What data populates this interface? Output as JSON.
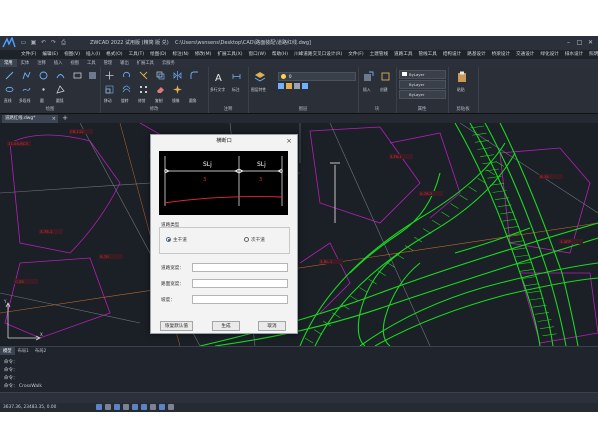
{
  "app": {
    "title": "ZWCAD 2022 试用版 (精简 版 兑)",
    "file_path": "C:\\Users\\wsnsens\\Desktop\\CAD\\路面装配\\道路红线.dwg]",
    "quick_access": [
      "open-icon",
      "save-icon",
      "undo-icon",
      "redo-icon",
      "print-icon"
    ],
    "window_buttons": [
      "–",
      "□",
      "✕"
    ]
  },
  "menu": [
    "文件(F)",
    "编辑(E)",
    "视图(V)",
    "插入(I)",
    "格式(O)",
    "工具(T)",
    "绘图(D)",
    "标注(N)",
    "修改(M)",
    "扩展工具(X)",
    "窗口(W)",
    "帮助(H)",
    "川峰道路交叉口设计(R)",
    "文件(F)",
    "土建管线",
    "道路工具",
    "管线工具",
    "结构设计",
    "路基设计",
    "桥梁设计",
    "交通设计",
    "绿化设计",
    "排水设计",
    "照明设计",
    "建筑设计"
  ],
  "ribbon_tabs": [
    "常用",
    "实体",
    "注释",
    "插入",
    "视图",
    "工具",
    "管理",
    "输出",
    "扩展工具",
    "云服务"
  ],
  "ribbon": {
    "groups": [
      "绘图",
      "修改",
      "注释",
      "图层",
      "块",
      "属性",
      "剪贴板"
    ],
    "draw_labels": [
      "直线",
      "多段线",
      "圆",
      "圆弧"
    ],
    "modify_labels": [
      "移动",
      "旋转",
      "修剪",
      "复制",
      "镜像",
      "圆角",
      "拉伸"
    ],
    "annot_labels": [
      "多行文字",
      "标注"
    ],
    "layer_label": "图层特性",
    "layer_current": "0",
    "block_labels": [
      "插入",
      "创建"
    ],
    "prop_values": [
      "ByLayer",
      "ByLayer",
      "ByLayer"
    ],
    "clip_labels": [
      "粘贴"
    ]
  },
  "document_tab": {
    "label": "道路红线.dwg*",
    "close": "×",
    "add": "+"
  },
  "drawing": {
    "red_labels": [
      "11.05-RC3",
      "CR-112",
      "C2-11",
      "3-75-1",
      "0-70",
      "C-55",
      "1-3FP1",
      "3-FK-1",
      "0-76-3",
      "R-15",
      "1-4FP",
      "3-RL-1"
    ]
  },
  "dialog": {
    "title": "横断口",
    "close": "×",
    "preview_labels": [
      "SLj",
      "SLj"
    ],
    "preview_red_labels": [
      "3",
      "3"
    ],
    "group_label": "道路类型",
    "radio_options": [
      "主干道",
      "次干道"
    ],
    "radio_selected": 0,
    "fields": [
      {
        "label": "道路宽度：",
        "value": ""
      },
      {
        "label": "路面宽度：",
        "value": ""
      },
      {
        "label": "坡度：",
        "value": ""
      }
    ],
    "buttons": [
      "恢复默认值",
      "生成",
      "取消"
    ]
  },
  "command": {
    "tabs": [
      "模型",
      "布局1",
      "布局2"
    ],
    "lines": [
      "命令：",
      "命令：",
      "命令：",
      "命令：  CrossWalk"
    ]
  },
  "status": {
    "coords": "3637.36, 23483.35, 0.00",
    "icons": [
      "grid-icon",
      "snap-icon",
      "ortho-icon",
      "polar-icon",
      "osnap-icon",
      "otrack-icon",
      "lweight-icon",
      "model-icon",
      "settings-icon"
    ]
  },
  "colors": {
    "canvas": "#1b1f26",
    "road_green": "#19d81f",
    "parcel_magenta": "#b520b5",
    "label_red": "#e8283a",
    "dialog_bg": "#f3f3f3"
  }
}
